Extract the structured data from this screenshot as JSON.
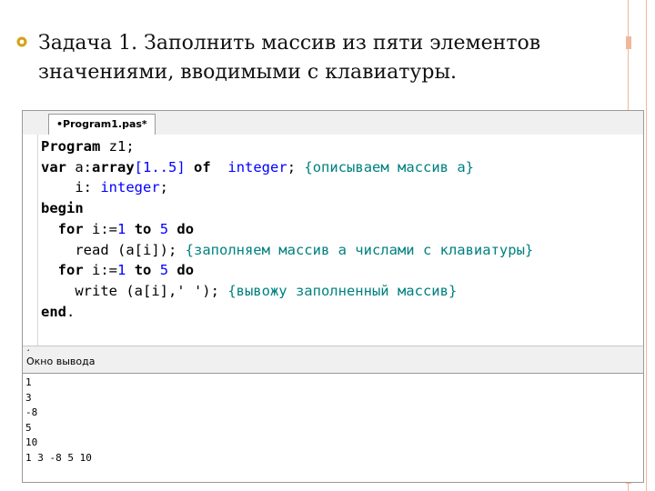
{
  "slide": {
    "title": "Задача 1. Заполнить массив из пяти элементов значениями, вводимыми с клавиатуры."
  },
  "ide": {
    "tab_label": "•Program1.pas*",
    "output_panel_title": "Окно вывода",
    "code": {
      "l1_kw": "Program",
      "l1_rest": " z1;",
      "l2_kw1": "var",
      "l2_a": " a:",
      "l2_kw2": "array",
      "l2_range": "[1..5]",
      "l2_kw3": "of",
      "l2_type": "integer",
      "l2_semi": ";",
      "l2_comment": "{описываем массив a}",
      "l3_i": "i: ",
      "l3_type": "integer",
      "l3_semi": ";",
      "l4_kw": "begin",
      "l5_kw1": "for",
      "l5_i": " i:=",
      "l5_n1": "1",
      "l5_kw2": "to",
      "l5_n2": "5",
      "l5_kw3": "do",
      "l6_read": "read (a[i]);",
      "l6_comment": "{заполняем массив a числами с клавиатуры}",
      "l7_kw1": "for",
      "l7_i": " i:=",
      "l7_n1": "1",
      "l7_kw2": "to",
      "l7_n2": "5",
      "l7_kw3": "do",
      "l8_write": "write (a[i],' ');",
      "l8_comment": "{вывожу заполненный массив}",
      "l9_kw": "end",
      "l9_dot": "."
    },
    "output_lines": [
      "1",
      "3",
      "-8",
      "5",
      "10",
      "1 3 -8 5 10"
    ]
  },
  "colors": {
    "keyword": "#000000",
    "type": "#0000ff",
    "comment": "#008080",
    "deco": "#f0b89a"
  }
}
